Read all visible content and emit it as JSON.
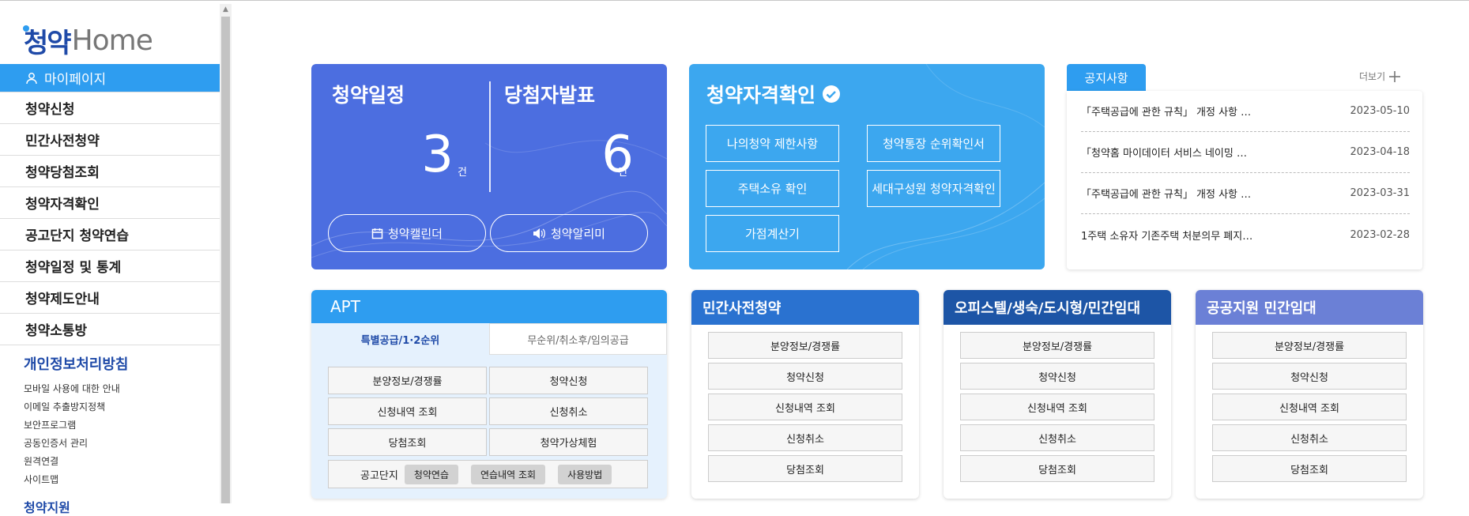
{
  "sidebar": {
    "logo_ko": "청약",
    "logo_en": "Home",
    "items": [
      {
        "label": "마이페이지"
      },
      {
        "label": "청약신청"
      },
      {
        "label": "민간사전청약"
      },
      {
        "label": "청약당첨조회"
      },
      {
        "label": "청약자격확인"
      },
      {
        "label": "공고단지 청약연습"
      },
      {
        "label": "청약일정 및 통계"
      },
      {
        "label": "청약제도안내"
      },
      {
        "label": "청약소통방"
      }
    ],
    "privacy": "개인정보처리방침",
    "links": [
      "모바일 사용에 대한 안내",
      "이메일 추출방지정책",
      "보안프로그램",
      "공동인증서 관리",
      "원격연결",
      "사이트맵"
    ],
    "more": "청약지원"
  },
  "schedule": {
    "title": "청약일정",
    "count": "3",
    "unit": "건",
    "winner_title": "당첨자발표",
    "winner_count": "6",
    "winner_unit": "건",
    "calendar_btn": "청약캘린더",
    "alarm_btn": "청약알리미"
  },
  "qualify": {
    "title": "청약자격확인",
    "buttons": [
      "나의청약 제한사항",
      "청약통장 순위확인서",
      "주택소유 확인",
      "세대구성원 청약자격확인",
      "가점계산기"
    ]
  },
  "notice": {
    "tab": "공지사항",
    "more": "더보기",
    "rows": [
      {
        "title": "「주택공급에 관한 규칙」 개정 사항 …",
        "date": "2023-05-10"
      },
      {
        "title": "「청약홈 마이데이터 서비스 네이밍 …",
        "date": "2023-04-18"
      },
      {
        "title": "「주택공급에 관한 규칙」 개정 사항 …",
        "date": "2023-03-31"
      },
      {
        "title": "1주택 소유자 기존주택 처분의무 폐지…",
        "date": "2023-02-28"
      }
    ]
  },
  "apt": {
    "title": "APT",
    "tab_on": "특별공급/1·2순위",
    "tab_off": "무순위/취소후/임의공급",
    "grid": [
      "분양정보/경쟁률",
      "청약신청",
      "신청내역 조회",
      "신청취소",
      "당첨조회",
      "청약가상체험"
    ],
    "gong_label": "공고단지",
    "chips": [
      "청약연습",
      "연습내역 조회",
      "사용방법"
    ]
  },
  "cards": [
    {
      "title": "민간사전청약",
      "color": "#2a72d0",
      "buttons": [
        "분양정보/경쟁률",
        "청약신청",
        "신청내역 조회",
        "신청취소",
        "당첨조회"
      ]
    },
    {
      "title": "오피스텔/생숙/도시형/민간임대",
      "color": "#1d55a6",
      "buttons": [
        "분양정보/경쟁률",
        "청약신청",
        "신청내역 조회",
        "신청취소",
        "당첨조회"
      ]
    },
    {
      "title": "공공지원 민간임대",
      "color": "#6b80d6",
      "buttons": [
        "분양정보/경쟁률",
        "청약신청",
        "신청내역 조회",
        "신청취소",
        "당첨조회"
      ]
    }
  ]
}
